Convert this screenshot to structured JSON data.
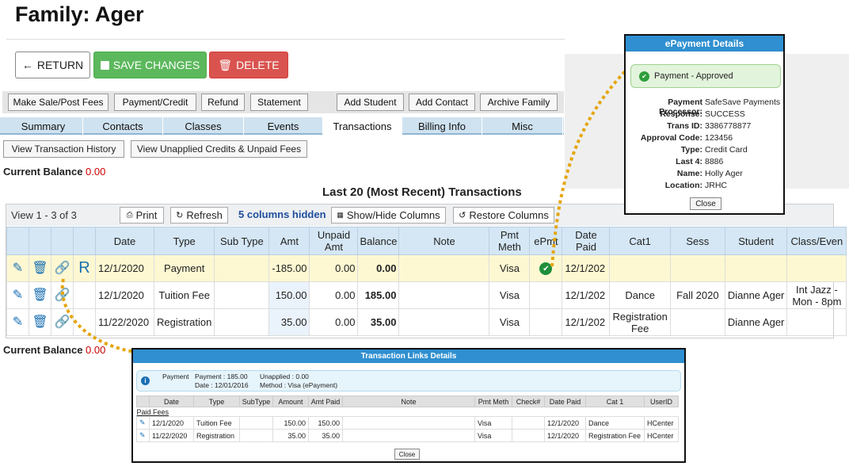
{
  "header": {
    "title": "Family: Ager"
  },
  "actions": {
    "return": "RETURN",
    "save": "SAVE CHANGES",
    "delete": "DELETE"
  },
  "toolbar": [
    "Make Sale/Post Fees",
    "Payment/Credit",
    "Refund",
    "Statement",
    "Add Student",
    "Add Contact",
    "Archive Family"
  ],
  "tabs": [
    "Summary",
    "Contacts",
    "Classes",
    "Events",
    "Transactions",
    "Billing Info",
    "Misc"
  ],
  "active_tab": "Transactions",
  "subbuttons": [
    "View Transaction History",
    "View Unapplied Credits & Unpaid Fees"
  ],
  "balance": {
    "label": "Current Balance",
    "value": "0.00"
  },
  "transactions": {
    "title": "Last 20 (Most Recent) Transactions",
    "view_count": "View 1 - 3 of 3",
    "print": "Print",
    "refresh": "Refresh",
    "hidden_cols": "5 columns hidden",
    "show_hide": "Show/Hide Columns",
    "restore": "Restore Columns",
    "columns": [
      "Date",
      "Type",
      "Sub Type",
      "Amt",
      "Unpaid Amt",
      "Balance",
      "Note",
      "Pmt Meth",
      "ePmt",
      "Date Paid",
      "Cat1",
      "Sess",
      "Student",
      "Class/Even"
    ],
    "rows": [
      {
        "date": "12/1/2020",
        "type": "Payment",
        "subtype": "",
        "amt": "-185.00",
        "unpaid": "0.00",
        "balance": "0.00",
        "note": "",
        "pmt": "Visa",
        "epmt": "✔",
        "paid": "12/1/202",
        "cat1": "",
        "sess": "",
        "student": "",
        "class": "",
        "r": "R"
      },
      {
        "date": "12/1/2020",
        "type": "Tuition Fee",
        "subtype": "",
        "amt": "150.00",
        "unpaid": "0.00",
        "balance": "185.00",
        "note": "",
        "pmt": "Visa",
        "epmt": "",
        "paid": "12/1/202",
        "cat1": "Dance",
        "sess": "Fall 2020",
        "student": "Dianne Ager",
        "class": "Int Jazz - Mon - 8pm",
        "r": ""
      },
      {
        "date": "11/22/2020",
        "type": "Registration",
        "subtype": "",
        "amt": "35.00",
        "unpaid": "0.00",
        "balance": "35.00",
        "note": "",
        "pmt": "Visa",
        "epmt": "",
        "paid": "12/1/202",
        "cat1": "Registration Fee",
        "sess": "",
        "student": "Dianne Ager",
        "class": "",
        "r": ""
      }
    ]
  },
  "epayment": {
    "title": "ePayment Details",
    "status": "Payment - Approved",
    "fields": [
      {
        "k": "Payment Processor:",
        "v": "SafeSave Payments"
      },
      {
        "k": "Response:",
        "v": "SUCCESS"
      },
      {
        "k": "Trans ID:",
        "v": "3386778877"
      },
      {
        "k": "Approval Code:",
        "v": "123456"
      },
      {
        "k": "Type:",
        "v": "Credit Card"
      },
      {
        "k": "Last 4:",
        "v": "8886"
      },
      {
        "k": "Name:",
        "v": "Holly Ager"
      },
      {
        "k": "Location:",
        "v": "JRHC"
      }
    ],
    "close": "Close"
  },
  "links": {
    "title": "Transaction Links Details",
    "info_type": "Payment",
    "info_payment": "Payment : 185.00",
    "info_unapplied": "Unapplied : 0.00",
    "info_date": "Date : 12/01/2016",
    "info_method": "Method : Visa (ePayment)",
    "columns": [
      "",
      "Date",
      "Type",
      "SubType",
      "Amount",
      "Amt Paid",
      "Note",
      "Pmt Meth",
      "Check#",
      "Date Paid",
      "Cat 1",
      "UserID"
    ],
    "group": "Paid Fees",
    "rows": [
      {
        "date": "12/1/2020",
        "type": "Tuition Fee",
        "subtype": "",
        "amount": "150.00",
        "paid": "150.00",
        "note": "",
        "pmt": "Visa",
        "check": "",
        "datepaid": "12/1/2020",
        "cat": "Dance",
        "user": "HCenter"
      },
      {
        "date": "11/22/2020",
        "type": "Registration",
        "subtype": "",
        "amount": "35.00",
        "paid": "35.00",
        "note": "",
        "pmt": "Visa",
        "check": "",
        "datepaid": "12/1/2020",
        "cat": "Registration Fee",
        "user": "HCenter"
      }
    ],
    "close": "Close"
  },
  "colors": {
    "accent": "#2f8fd0",
    "save": "#5cb85c",
    "delete": "#d9534f",
    "arrow": "#e5a50a"
  }
}
